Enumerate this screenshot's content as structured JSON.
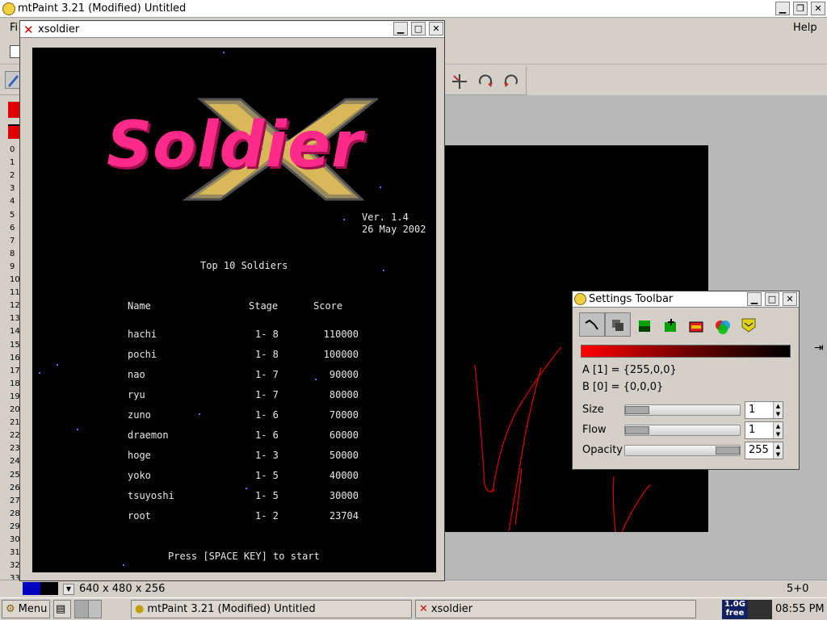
{
  "mtpaint": {
    "title": "mtPaint 3.21 (Modified) Untitled",
    "menu_left": "Fi",
    "menu_help": "Help",
    "status_dims": "640 x 480 x 256",
    "status_coords": "5+0",
    "ruler_numbers": [
      "0",
      "1",
      "2",
      "3",
      "4",
      "5",
      "6",
      "7",
      "8",
      "9",
      "10",
      "11",
      "12",
      "13",
      "14",
      "15",
      "16",
      "17",
      "18",
      "19",
      "20",
      "21",
      "22",
      "23",
      "24",
      "25",
      "26",
      "27",
      "28",
      "29",
      "30",
      "31",
      "32",
      "33"
    ]
  },
  "xsoldier": {
    "title": "xsoldier",
    "logo_word": "Soldier",
    "logo_x": "X",
    "version": "Ver. 1.4",
    "date": "26 May 2002",
    "heading": "Top 10 Soldiers",
    "columns": {
      "name": "Name",
      "stage": "Stage",
      "score": "Score"
    },
    "rows": [
      {
        "name": "hachi",
        "stage": "1- 8",
        "score": "110000"
      },
      {
        "name": "pochi",
        "stage": "1- 8",
        "score": "100000"
      },
      {
        "name": "nao",
        "stage": "1- 7",
        "score": "90000"
      },
      {
        "name": "ryu",
        "stage": "1- 7",
        "score": "80000"
      },
      {
        "name": "zuno",
        "stage": "1- 6",
        "score": "70000"
      },
      {
        "name": "draemon",
        "stage": "1- 6",
        "score": "60000"
      },
      {
        "name": "hoge",
        "stage": "1- 3",
        "score": "50000"
      },
      {
        "name": "yoko",
        "stage": "1- 5",
        "score": "40000"
      },
      {
        "name": "tsuyoshi",
        "stage": "1- 5",
        "score": "30000"
      },
      {
        "name": "root",
        "stage": "1- 2",
        "score": "23704"
      }
    ],
    "prompt": "Press [SPACE KEY] to start"
  },
  "settings": {
    "title": "Settings Toolbar",
    "color_a": "A [1] = {255,0,0}",
    "color_b": "B [0] = {0,0,0}",
    "size_label": "Size",
    "size_value": "1",
    "flow_label": "Flow",
    "flow_value": "1",
    "opacity_label": "Opacity",
    "opacity_value": "255"
  },
  "taskbar": {
    "menu_label": "Menu",
    "task_mtpaint": "mtPaint 3.21 (Modified) Untitled",
    "task_xsoldier": "xsoldier",
    "mem_top": "1.0G",
    "mem_bottom": "free",
    "clock": "08:55 PM"
  },
  "colors": {
    "logo_pink": "#ff2a8a",
    "logo_gold": "#c8a040",
    "accent_red": "#e00000"
  }
}
